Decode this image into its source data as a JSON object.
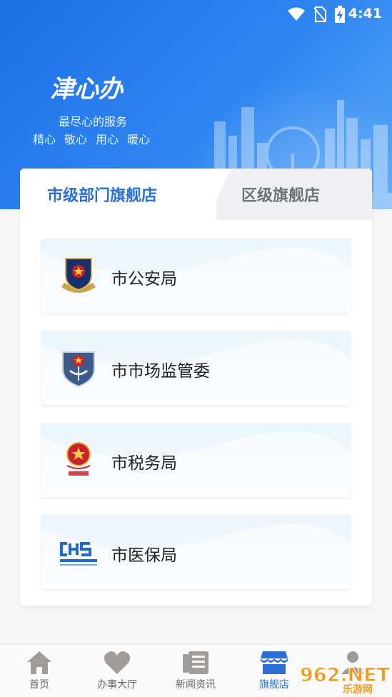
{
  "status_bar": {
    "time": "4:41",
    "icons": [
      "wifi-icon",
      "no-sim-icon",
      "battery-charging-icon"
    ]
  },
  "header": {
    "logo_text": "津心办",
    "slogan": "最尽心的服务",
    "slogan_items": [
      "精心",
      "敬心",
      "用心",
      "暖心"
    ]
  },
  "tabs": [
    {
      "label": "市级部门旗舰店",
      "active": true
    },
    {
      "label": "区级旗舰店",
      "active": false
    }
  ],
  "stores": [
    {
      "name": "市公安局",
      "icon": "police-emblem-icon"
    },
    {
      "name": "市市场监管委",
      "icon": "market-supervision-emblem-icon"
    },
    {
      "name": "市税务局",
      "icon": "tax-emblem-icon"
    },
    {
      "name": "市医保局",
      "icon": "chs-logo-icon"
    }
  ],
  "bottom_nav": [
    {
      "label": "首页",
      "icon": "home-icon",
      "active": false
    },
    {
      "label": "办事大厅",
      "icon": "heart-icon",
      "active": false
    },
    {
      "label": "新闻资讯",
      "icon": "news-icon",
      "active": false
    },
    {
      "label": "旗舰店",
      "icon": "store-icon",
      "active": true
    },
    {
      "label": "",
      "icon": "user-icon",
      "active": false
    }
  ],
  "watermark": {
    "text": "962.NET",
    "subtext": "乐游网"
  },
  "colors": {
    "primary": "#2b6fd6",
    "header": "#2f86f2"
  }
}
